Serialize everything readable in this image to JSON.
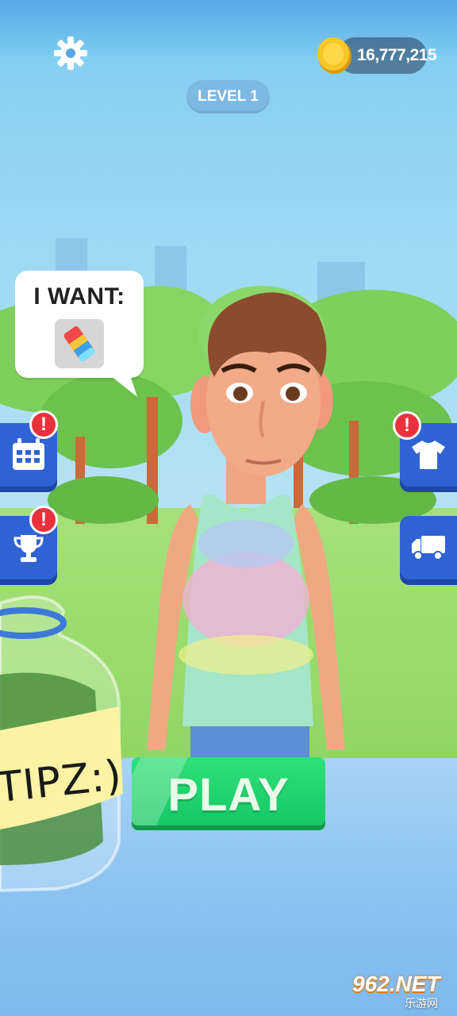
{
  "hud": {
    "coins": "16,777,215",
    "level": "LEVEL 1",
    "settings_icon": "gear-icon",
    "coin_icon": "coin-icon"
  },
  "request": {
    "title": "I WANT:",
    "item_icon": "eraser-icon"
  },
  "left_menu": [
    {
      "name": "calendar",
      "icon": "calendar-icon",
      "alert": "!"
    },
    {
      "name": "trophy",
      "icon": "trophy-icon",
      "alert": "!"
    }
  ],
  "right_menu": [
    {
      "name": "shirt",
      "icon": "shirt-icon",
      "alert": "!"
    },
    {
      "name": "truck",
      "icon": "truck-icon"
    }
  ],
  "tip_jar": {
    "label": "TIPZ:)"
  },
  "play": {
    "label": "PLAY"
  },
  "watermark": {
    "brand": "962.NET",
    "sub": "乐游网"
  },
  "colors": {
    "menu_button": "#2f63d4",
    "alert": "#e8313c",
    "play_button": "#1fd26c",
    "sky": "#9bd8f3",
    "grass": "#97db6c"
  }
}
